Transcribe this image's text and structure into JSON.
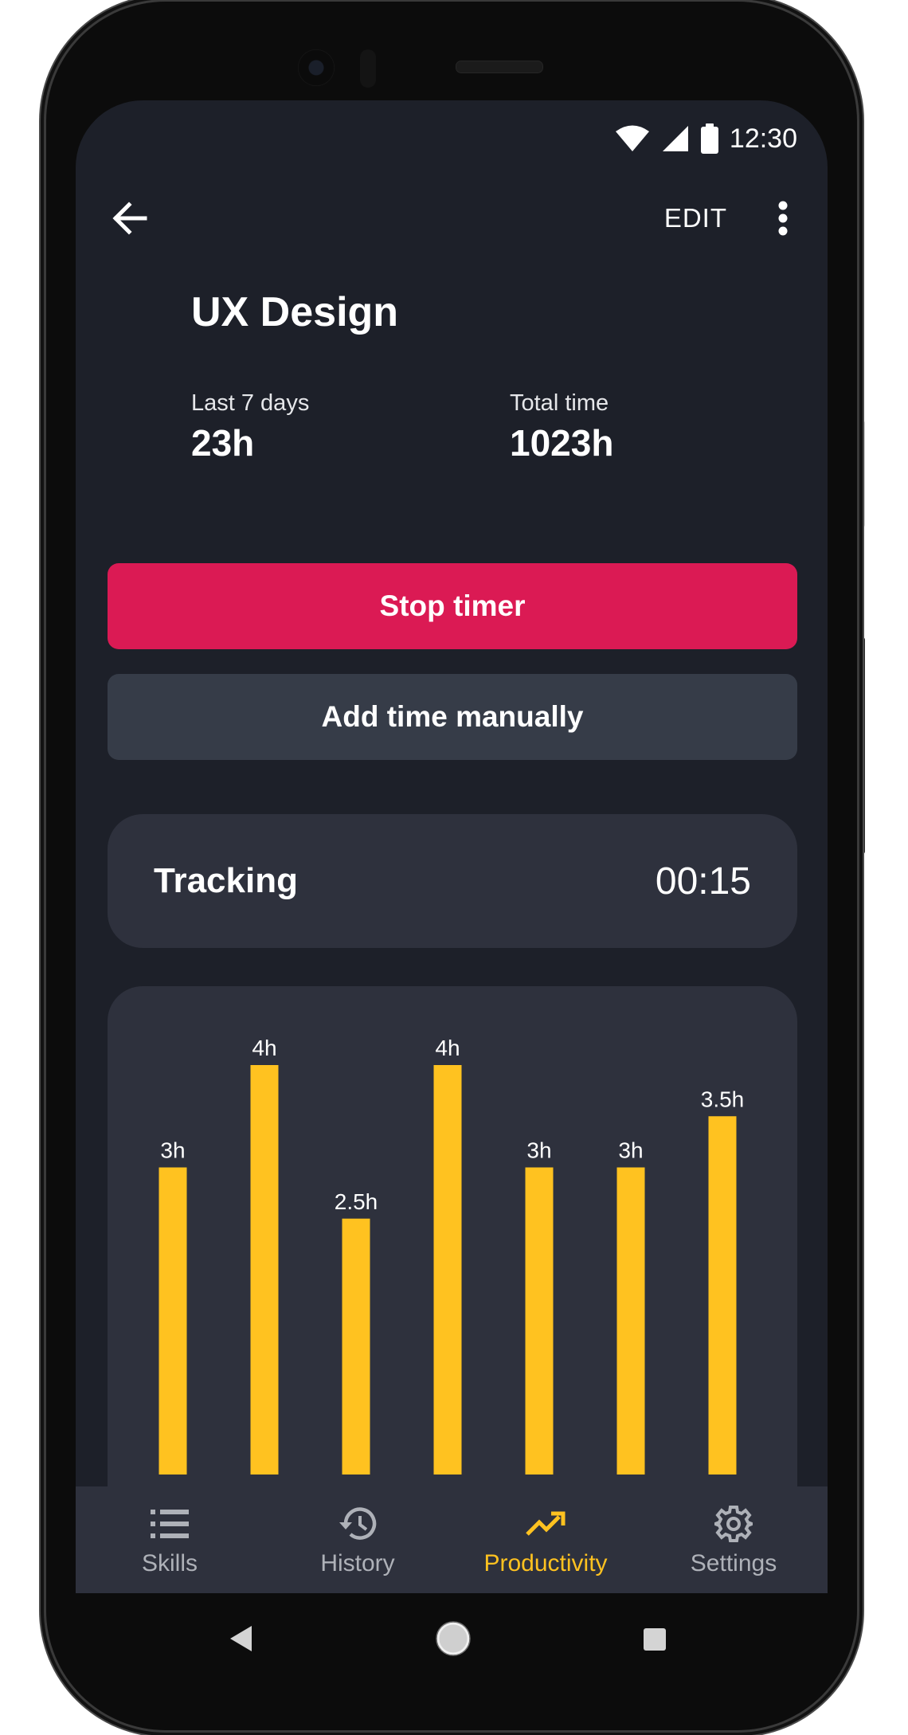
{
  "status": {
    "time": "12:30"
  },
  "appbar": {
    "edit_label": "EDIT"
  },
  "skill": {
    "title": "UX Design",
    "last7_label": "Last 7 days",
    "last7_value": "23h",
    "total_label": "Total time",
    "total_value": "1023h"
  },
  "actions": {
    "stop_label": "Stop timer",
    "add_label": "Add time manually"
  },
  "tracking": {
    "label": "Tracking",
    "value": "00:15"
  },
  "chart_data": {
    "type": "bar",
    "values": [
      3,
      4,
      2.5,
      4,
      3,
      3,
      3.5
    ],
    "labels": [
      "3h",
      "4h",
      "2.5h",
      "4h",
      "3h",
      "3h",
      "3.5h"
    ],
    "bar_color": "#ffc220"
  },
  "nav": {
    "items": [
      {
        "label": "Skills",
        "icon": "list-icon"
      },
      {
        "label": "History",
        "icon": "history-icon"
      },
      {
        "label": "Productivity",
        "icon": "trending-up-icon"
      },
      {
        "label": "Settings",
        "icon": "gear-icon"
      }
    ],
    "active": "Productivity",
    "active_color": "#ffc220"
  },
  "colors": {
    "stop_button": "#db1a54",
    "background": "#1d2029",
    "card": "#2e313d"
  }
}
